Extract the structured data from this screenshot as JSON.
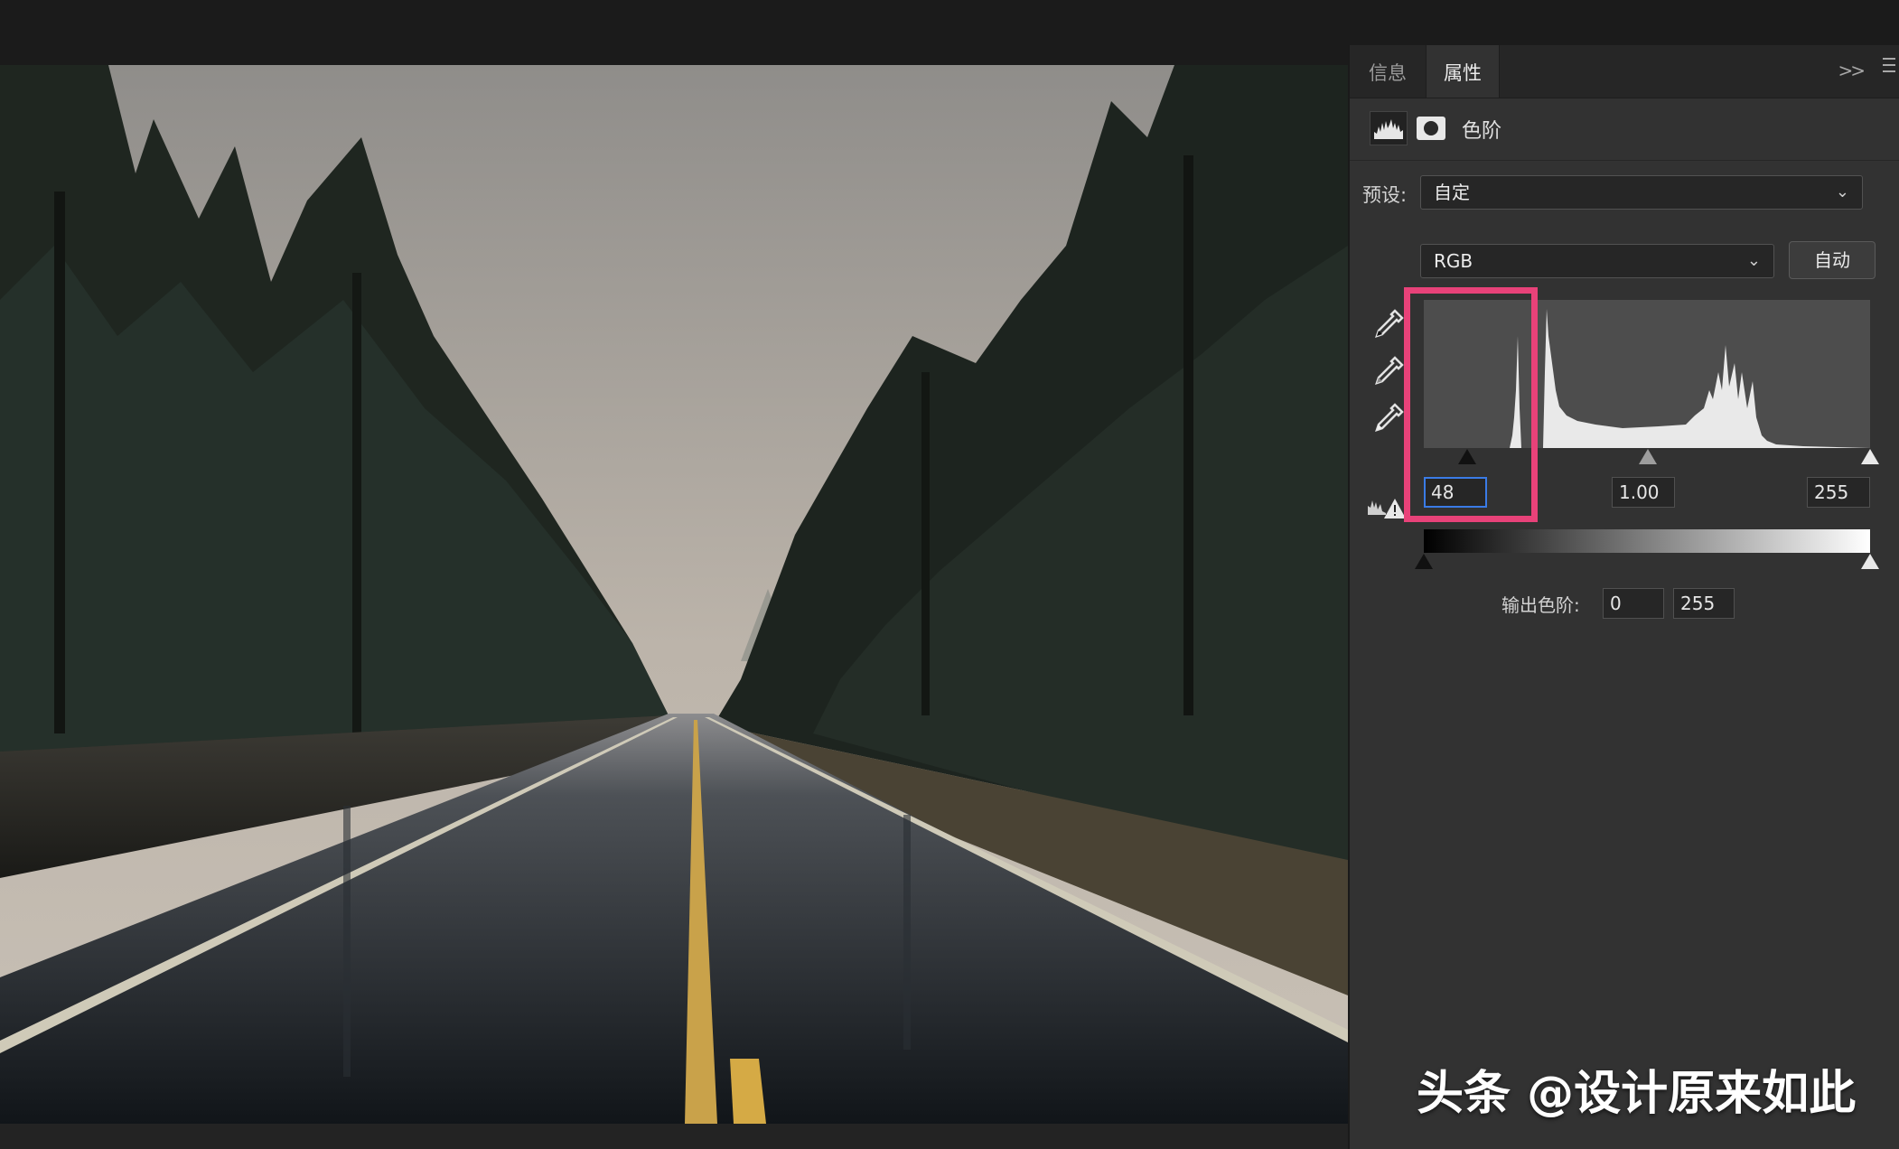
{
  "panel": {
    "tabs": [
      {
        "label": "信息",
        "active": false
      },
      {
        "label": "属性",
        "active": true
      }
    ],
    "collapse_glyph": ">>",
    "adjustment": {
      "title": "色阶",
      "icons": [
        "levels-histogram-icon",
        "layer-mask-icon"
      ]
    },
    "preset": {
      "label": "预设:",
      "value": "自定"
    },
    "channel": {
      "value": "RGB"
    },
    "auto_label": "自动",
    "eyedroppers": [
      "black-point-eyedropper-icon",
      "gray-point-eyedropper-icon",
      "white-point-eyedropper-icon"
    ],
    "input_levels": {
      "black": "48",
      "gamma": "1.00",
      "white": "255"
    },
    "output_levels": {
      "label": "输出色阶:",
      "black": "0",
      "white": "255"
    }
  },
  "highlight_color": "#e84279",
  "watermark": "头条 @设计原来如此"
}
